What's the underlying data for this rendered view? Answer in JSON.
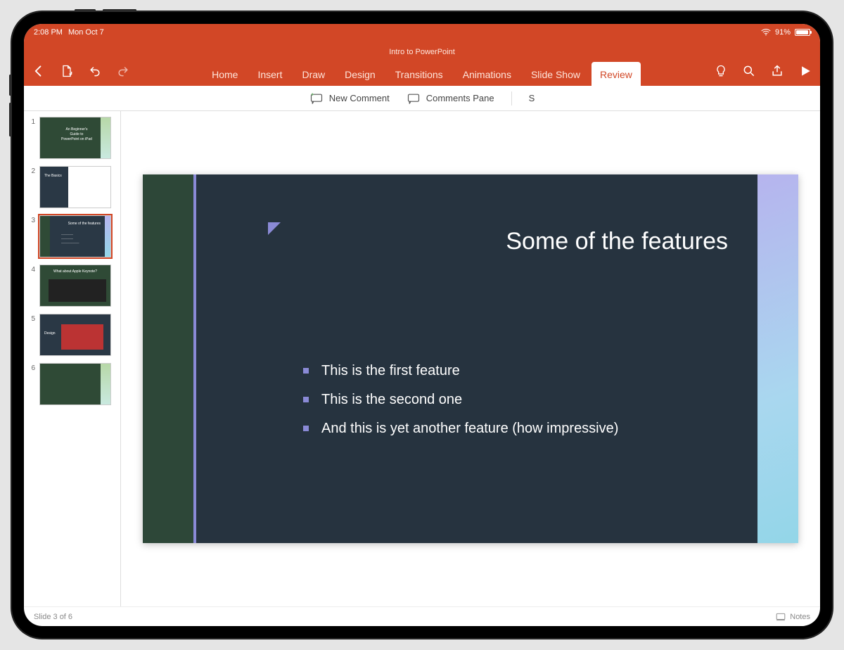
{
  "statusbar": {
    "time": "2:08 PM",
    "date": "Mon Oct 7",
    "battery_pct": "91%"
  },
  "doc_title": "Intro to PowerPoint",
  "tabs": {
    "home": "Home",
    "insert": "Insert",
    "draw": "Draw",
    "design": "Design",
    "transitions": "Transitions",
    "animations": "Animations",
    "slideshow": "Slide Show",
    "review": "Review"
  },
  "active_tab": "review",
  "ribbon": {
    "new_comment": "New Comment",
    "comments_pane": "Comments Pane",
    "s": "S"
  },
  "thumbs": [
    {
      "num": "1",
      "title": "An Beginner's Guide to PowerPoint on iPad"
    },
    {
      "num": "2",
      "title": "The Basics"
    },
    {
      "num": "3",
      "title": "Some of the features"
    },
    {
      "num": "4",
      "title": "What about Apple Keynote?"
    },
    {
      "num": "5",
      "title": "Design"
    },
    {
      "num": "6",
      "title": ""
    }
  ],
  "selected_thumb": 2,
  "slide": {
    "title": "Some of the features",
    "bullets": [
      "This is the first feature",
      "This is the second one",
      "And this is yet another feature (how impressive)"
    ]
  },
  "footer": {
    "slide_pos": "Slide 3 of 6",
    "notes_label": "Notes"
  },
  "icons": {
    "back": "back-icon",
    "file": "file-icon",
    "undo": "undo-icon",
    "redo": "redo-icon",
    "hint": "lightbulb-icon",
    "search": "search-icon",
    "share": "share-icon",
    "play": "play-icon",
    "new_comment": "comment-plus-icon",
    "comments_pane": "comment-icon",
    "notes": "notes-icon",
    "wifi": "wifi-icon",
    "battery": "battery-icon"
  }
}
